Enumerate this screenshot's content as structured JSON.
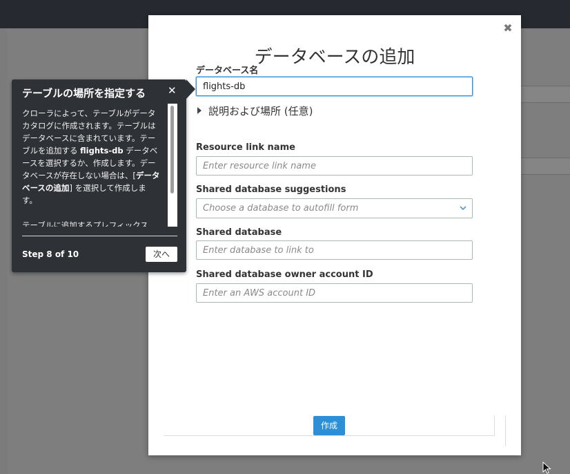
{
  "modal": {
    "title": "データベースの追加",
    "database_name_label": "データベース名",
    "database_name_value": "flights-db",
    "optional_section": "説明および場所 (任意)",
    "resource_link_label": "Resource link name",
    "resource_link_placeholder": "Enter resource link name",
    "shared_suggestions_label": "Shared database suggestions",
    "shared_suggestions_placeholder": "Choose a database to autofill form",
    "shared_database_label": "Shared database",
    "shared_database_placeholder": "Enter database to link to",
    "owner_account_label": "Shared database owner account ID",
    "owner_account_placeholder": "Enter an AWS account ID",
    "create_label": "作成"
  },
  "tour": {
    "title": "テーブルの場所を指定する",
    "body_1": "クローラによって、テーブルがデータカタログに作成されます。テーブルはデータベースに含まれています。テーブルを追加する ",
    "body_db": "flights-db",
    "body_2": " データベースを選択するか、作成します。データベースが存在しない場合は、[",
    "body_add": "データベースの追加",
    "body_3": "] を選択して作成します。",
    "body_4": "テーブルに追加するプレフィックス",
    "step": "Step 8 of 10",
    "next_label": "次へ"
  },
  "icons": {
    "modal_close": "close-icon",
    "tour_close": "close-icon",
    "expand": "caret-right-icon",
    "dropdown": "chevron-down-icon"
  },
  "colors": {
    "primary": "#2d8fd5",
    "topbar": "#262a30",
    "popover": "#2e3136"
  }
}
